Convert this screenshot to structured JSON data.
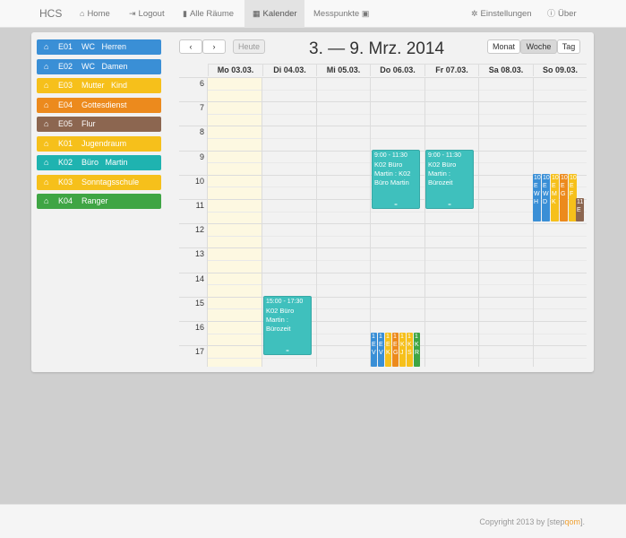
{
  "nav": {
    "brand": "HCS",
    "home": "Home",
    "logout": "Logout",
    "rooms": "Alle Räume",
    "calendar": "Kalender",
    "measure": "Messpunkte",
    "settings": "Einstellungen",
    "about": "Über"
  },
  "rooms": [
    {
      "code": "E01",
      "name": "WC   Herren",
      "color": "#3a8fd6"
    },
    {
      "code": "E02",
      "name": "WC   Damen",
      "color": "#3a8fd6"
    },
    {
      "code": "E03",
      "name": "Mutter   Kind",
      "color": "#f6c01b"
    },
    {
      "code": "E04",
      "name": "Gottesdienst",
      "color": "#ec8a1d"
    },
    {
      "code": "E05",
      "name": "Flur",
      "color": "#8c6650"
    },
    {
      "code": "K01",
      "name": "Jugendraum",
      "color": "#f6c01b"
    },
    {
      "code": "K02",
      "name": "Büro   Martin",
      "color": "#1fb3b0"
    },
    {
      "code": "K03",
      "name": "Sonntagsschule",
      "color": "#f6c01b"
    },
    {
      "code": "K04",
      "name": "Ranger",
      "color": "#3fa544"
    }
  ],
  "toolbar": {
    "prev": "‹",
    "next": "›",
    "today": "Heute",
    "title": "3. — 9. Mrz. 2014",
    "month": "Monat",
    "week": "Woche",
    "day": "Tag"
  },
  "days": [
    "Mo 03.03.",
    "Di 04.03.",
    "Mi 05.03.",
    "Do 06.03.",
    "Fr 07.03.",
    "Sa 08.03.",
    "So 09.03."
  ],
  "hours": [
    "6",
    "7",
    "8",
    "9",
    "10",
    "11",
    "12",
    "13",
    "14",
    "15",
    "16",
    "17"
  ],
  "events": [
    {
      "time": "9:00 - 11:30",
      "title": "K02 Büro Martin : K02 Büro Martin",
      "color": "#3fc0bd"
    },
    {
      "time": "9:00 - 11:30",
      "title": "K02 Büro Martin : Bürozeit",
      "color": "#3fc0bd"
    },
    {
      "time": "15:00 - 17:30",
      "title": "K02 Büro Martin : Bürozeit",
      "color": "#3fc0bd"
    }
  ],
  "sunday_blocks": [
    {
      "text": "10 E W H",
      "color": "#3a8fd6"
    },
    {
      "text": "10 E W D",
      "color": "#3a8fd6"
    },
    {
      "text": "10 E M K",
      "color": "#f6c01b"
    },
    {
      "text": "10 E G",
      "color": "#ec8a1d"
    },
    {
      "text": "10 E F",
      "color": "#f6c01b"
    },
    {
      "text": "11 E",
      "color": "#8c6650"
    }
  ],
  "thursday_blocks": [
    {
      "text": "1 E V",
      "color": "#3a8fd6"
    },
    {
      "text": "1 E V",
      "color": "#3a8fd6"
    },
    {
      "text": "1 E K",
      "color": "#f6c01b"
    },
    {
      "text": "1 E G",
      "color": "#ec8a1d"
    },
    {
      "text": "1 K J",
      "color": "#f6c01b"
    },
    {
      "text": "1 K S",
      "color": "#f6c01b"
    },
    {
      "text": "1 K R",
      "color": "#3fa544"
    }
  ],
  "footer": {
    "copyright": "Copyright 2013 by",
    "brand_open": "[",
    "brand_a": "step",
    "brand_b": "qom",
    "brand_close": "]."
  }
}
